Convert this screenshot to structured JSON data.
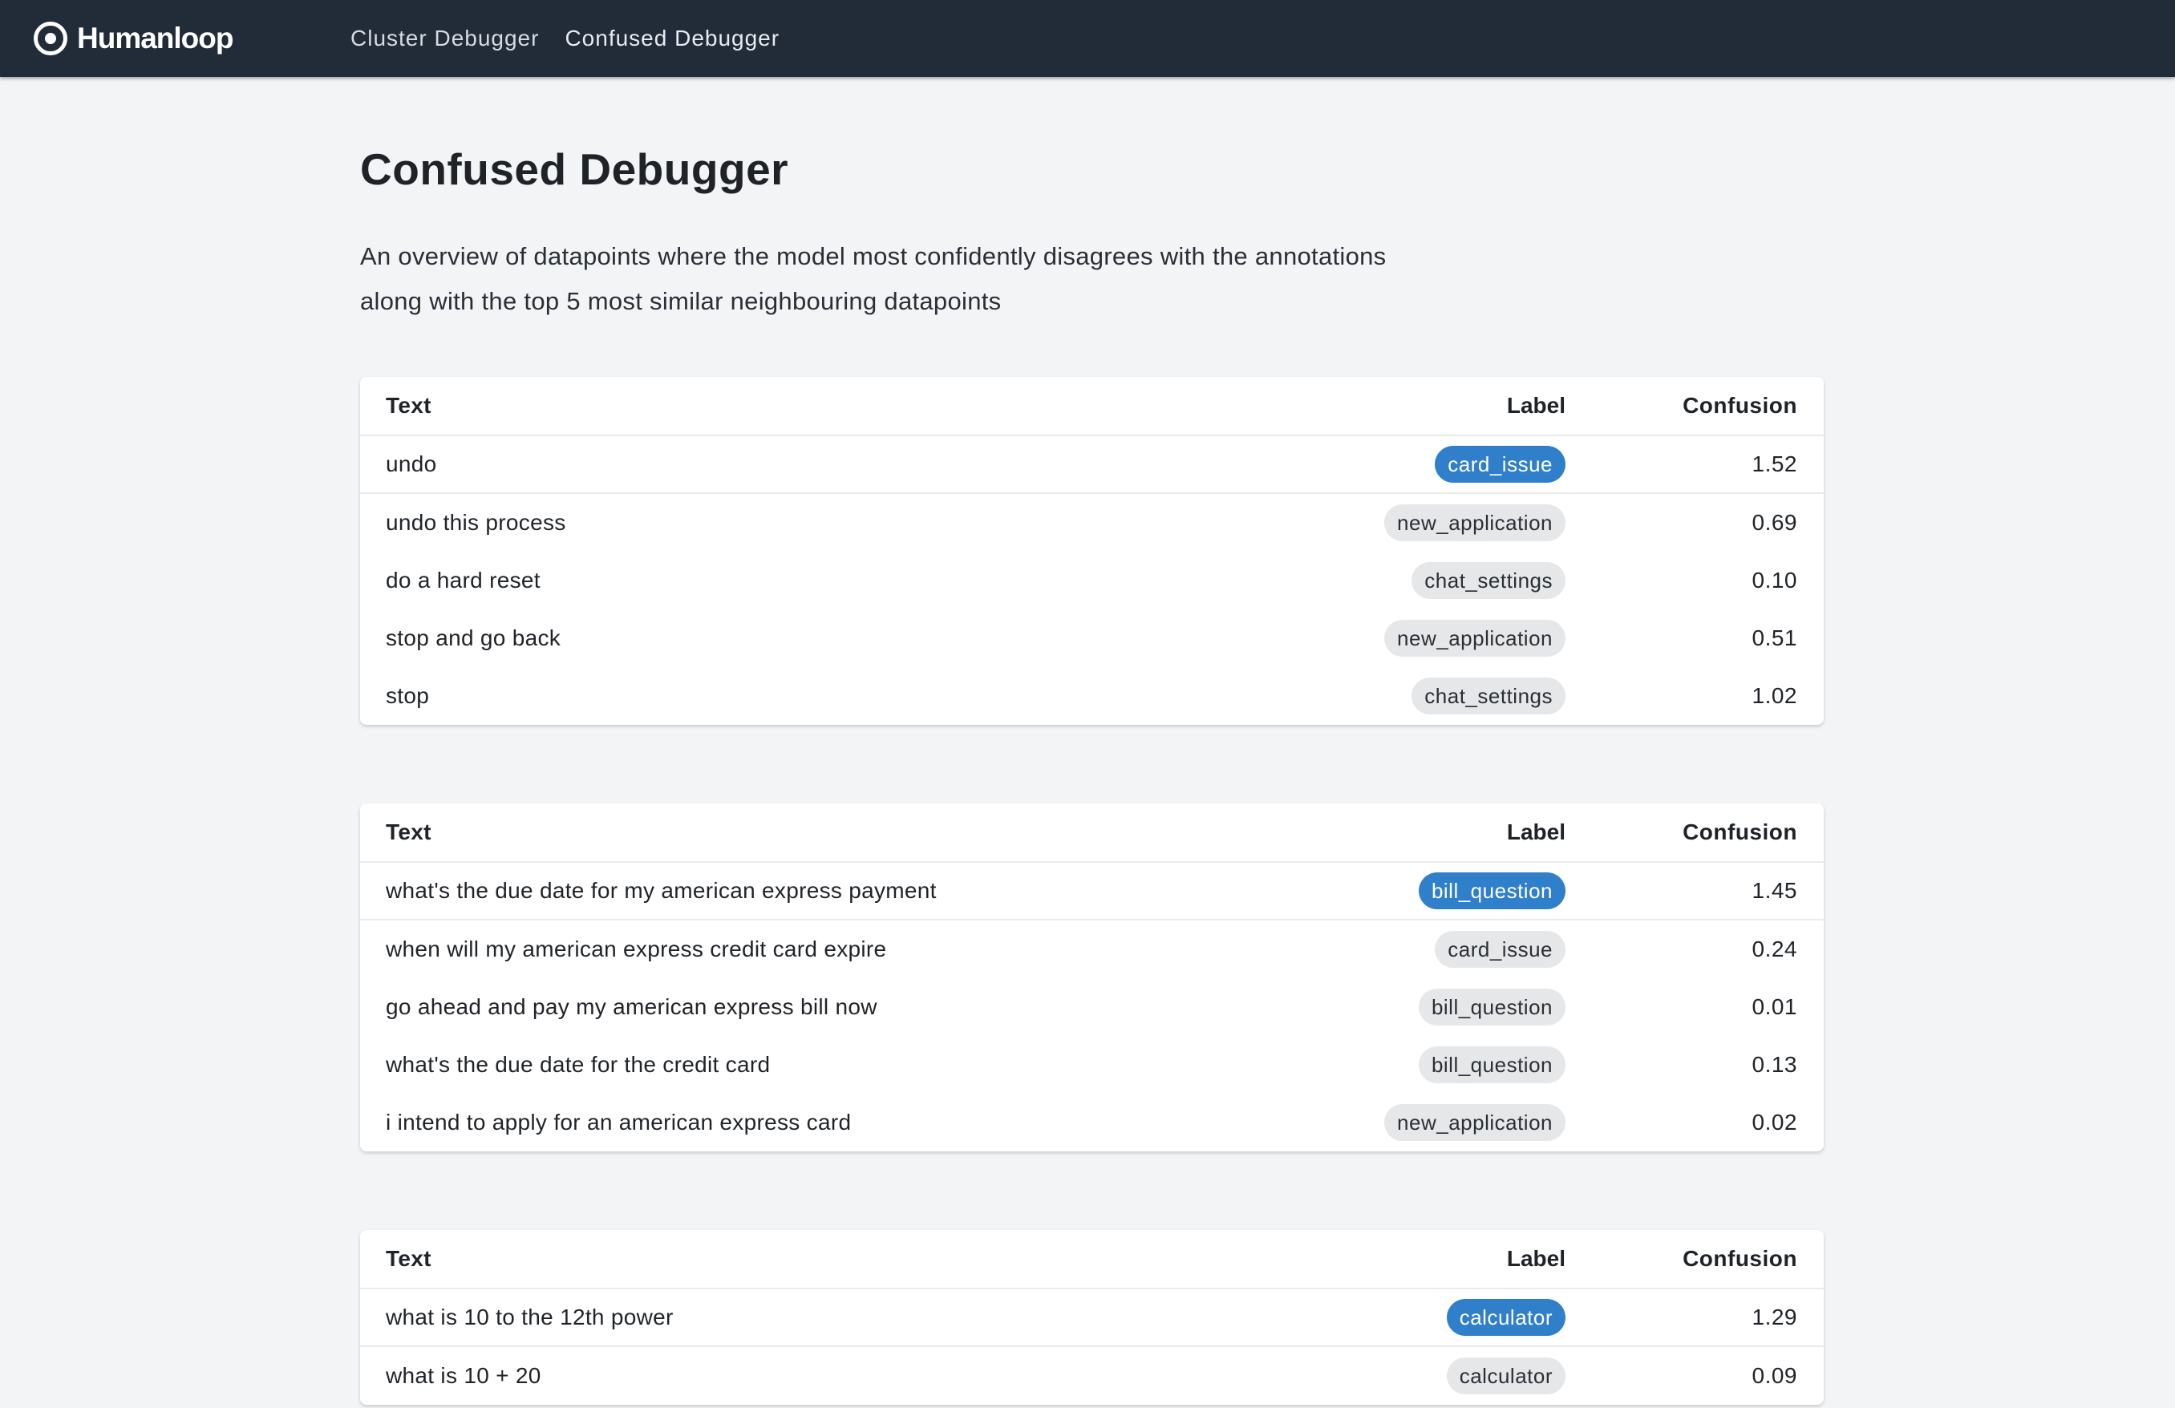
{
  "brand": {
    "name": "Humanloop",
    "icon": "humanloop-logo-icon"
  },
  "nav": {
    "items": [
      "Cluster Debugger",
      "Confused Debugger"
    ],
    "active": "Confused Debugger"
  },
  "page": {
    "title": "Confused Debugger",
    "intro_line1": "An overview of datapoints where the model most confidently disagrees with the annotations",
    "intro_line2": "along with the top 5 most similar neighbouring datapoints"
  },
  "columns": {
    "text": "Text",
    "label": "Label",
    "confusion": "Confusion"
  },
  "colors": {
    "primary_pill": "#2f7fcb",
    "neutral_pill": "#e6e7e9",
    "topbar": "#222b38",
    "background": "#f3f4f6"
  },
  "tables": [
    {
      "rows": [
        {
          "text": "undo",
          "label": "card_issue",
          "confusion": "1.52",
          "primary": true
        },
        {
          "text": "undo this process",
          "label": "new_application",
          "confusion": "0.69",
          "primary": false
        },
        {
          "text": "do a hard reset",
          "label": "chat_settings",
          "confusion": "0.10",
          "primary": false
        },
        {
          "text": "stop and go back",
          "label": "new_application",
          "confusion": "0.51",
          "primary": false
        },
        {
          "text": "stop",
          "label": "chat_settings",
          "confusion": "1.02",
          "primary": false
        }
      ]
    },
    {
      "rows": [
        {
          "text": "what's the due date for my american express payment",
          "label": "bill_question",
          "confusion": "1.45",
          "primary": true
        },
        {
          "text": "when will my american express credit card expire",
          "label": "card_issue",
          "confusion": "0.24",
          "primary": false
        },
        {
          "text": "go ahead and pay my american express bill now",
          "label": "bill_question",
          "confusion": "0.01",
          "primary": false
        },
        {
          "text": "what's the due date for the credit card",
          "label": "bill_question",
          "confusion": "0.13",
          "primary": false
        },
        {
          "text": "i intend to apply for an american express card",
          "label": "new_application",
          "confusion": "0.02",
          "primary": false
        }
      ]
    },
    {
      "rows": [
        {
          "text": "what is 10 to the 12th power",
          "label": "calculator",
          "confusion": "1.29",
          "primary": true
        },
        {
          "text": "what is 10 + 20",
          "label": "calculator",
          "confusion": "0.09",
          "primary": false
        }
      ]
    }
  ]
}
